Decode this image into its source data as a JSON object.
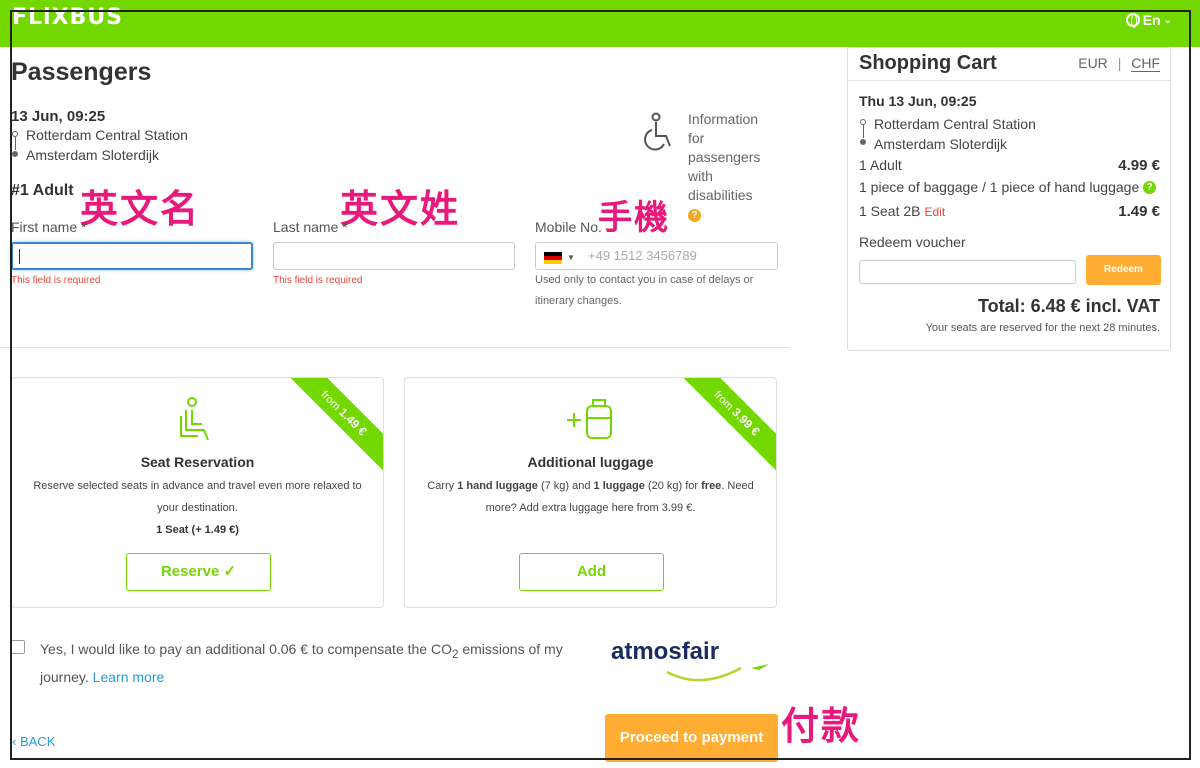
{
  "header": {
    "logo": "FLiXBUS",
    "language": "En"
  },
  "page_title": "Passengers",
  "trip": {
    "datetime": "13 Jun, 09:25",
    "from": "Rotterdam Central Station",
    "to": "Amsterdam Sloterdijk"
  },
  "accessibility": {
    "text": "Information for passengers with disabilities",
    "help": "?"
  },
  "passenger": {
    "heading": "#1 Adult",
    "first_name_label": "First name *",
    "last_name_label": "Last name *",
    "mobile_label": "Mobile No.",
    "first_name_value": "",
    "last_name_value": "",
    "mobile_placeholder": "+49 1512 3456789",
    "required_error": "This field is required",
    "mobile_hint": "Used only to contact you in case of delays or itinerary changes."
  },
  "handwritten": {
    "first_name_note": "英文名",
    "last_name_note": "英文姓",
    "mobile_note": "手機",
    "pay_note": "付款"
  },
  "seat_card": {
    "ribbon_prefix": "from",
    "ribbon_price": "1.49 €",
    "title": "Seat Reservation",
    "desc": "Reserve selected seats in advance and travel even more relaxed to your destination.",
    "summary": "1 Seat (+ 1.49 €)",
    "button": "Reserve ✓"
  },
  "luggage_card": {
    "ribbon_prefix": "from",
    "ribbon_price": "3.99 €",
    "title": "Additional luggage",
    "desc_1": "Carry ",
    "desc_hand": "1 hand luggage",
    "desc_2": " (7 kg) and ",
    "desc_lug": "1 luggage",
    "desc_3": " (20 kg) for ",
    "desc_free": "free",
    "desc_4": ". Need more? Add extra luggage here from 3.99 €.",
    "button": "Add"
  },
  "co2": {
    "text_a": "Yes, I would like to pay an additional 0.06 € to compensate the CO",
    "sub": "2",
    "text_b": " emissions of my journey. ",
    "link": "Learn more",
    "partner": "atmosfair"
  },
  "footer": {
    "back": "BACK",
    "proceed": "Proceed to payment"
  },
  "cart": {
    "title": "Shopping Cart",
    "currency_a": "EUR",
    "separator": "|",
    "currency_b": "CHF",
    "date": "Thu 13 Jun, 09:25",
    "from": "Rotterdam Central Station",
    "to": "Amsterdam Sloterdijk",
    "adult_label": "1 Adult",
    "adult_price": "4.99 €",
    "baggage": "1 piece of baggage / 1 piece of hand luggage",
    "seat_label": "1 Seat 2B",
    "seat_edit": "Edit",
    "seat_price": "1.49 €",
    "voucher_label": "Redeem voucher",
    "redeem": "Redeem",
    "total": "Total: 6.48 € incl. VAT",
    "reserved": "Your seats are reserved for the next 28 minutes."
  },
  "colors": {
    "brand": "#73d700",
    "accent": "#ffad33",
    "error": "#e5493a",
    "link": "#2a9bd6",
    "annotation": "#e8197a"
  }
}
